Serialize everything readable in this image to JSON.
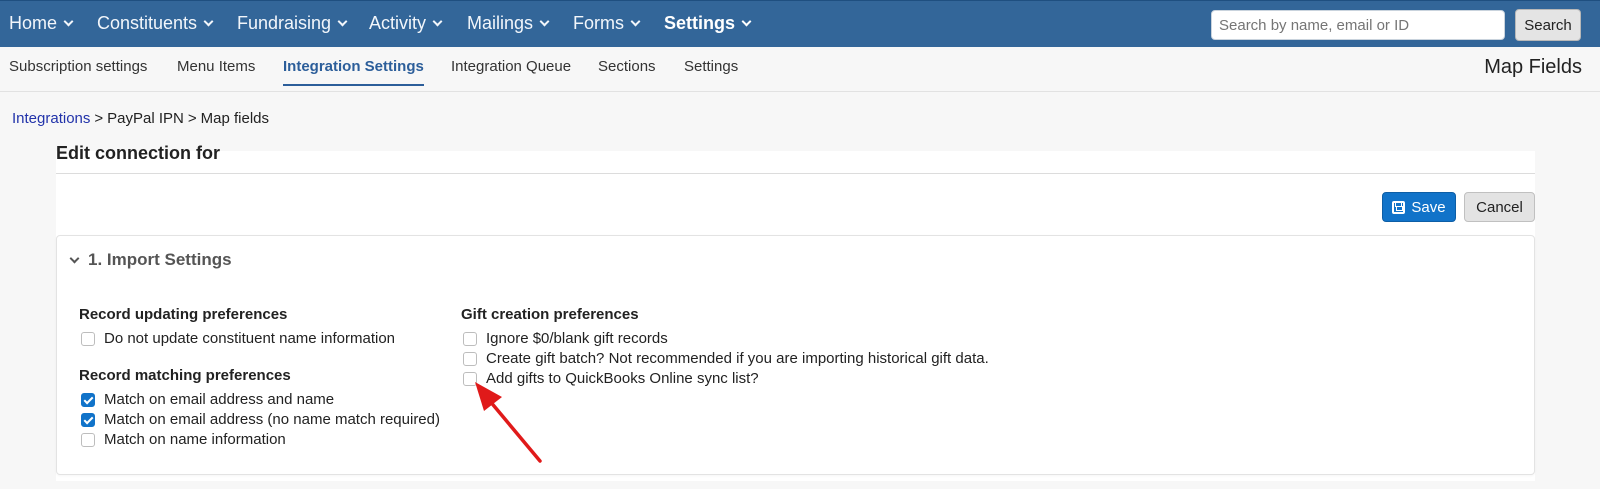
{
  "topnav": {
    "items": [
      {
        "label": "Home"
      },
      {
        "label": "Constituents"
      },
      {
        "label": "Fundraising"
      },
      {
        "label": "Activity"
      },
      {
        "label": "Mailings"
      },
      {
        "label": "Forms"
      },
      {
        "label": "Settings"
      }
    ],
    "active": "Settings",
    "search": {
      "placeholder": "Search by name, email or ID",
      "button_label": "Search"
    },
    "background_color": "#336699"
  },
  "subnav": {
    "items": [
      {
        "label": "Subscription settings"
      },
      {
        "label": "Menu Items"
      },
      {
        "label": "Integration Settings"
      },
      {
        "label": "Integration Queue"
      },
      {
        "label": "Sections"
      },
      {
        "label": "Settings"
      }
    ],
    "active": "Integration Settings",
    "page_title": "Map Fields"
  },
  "breadcrumb": {
    "items": [
      "Integrations",
      "PayPal IPN",
      "Map fields"
    ],
    "separator": ">"
  },
  "card": {
    "title": "Edit connection for",
    "save_label": "Save",
    "cancel_label": "Cancel",
    "accent_color": "#1173c9"
  },
  "section": {
    "title": "1. Import Settings",
    "record_updating": {
      "title": "Record updating preferences",
      "options": [
        {
          "label": "Do not update constituent name information",
          "checked": false
        }
      ]
    },
    "record_matching": {
      "title": "Record matching preferences",
      "options": [
        {
          "label": "Match on email address and name",
          "checked": true
        },
        {
          "label": "Match on email address (no name match required)",
          "checked": true
        },
        {
          "label": "Match on name information",
          "checked": false
        }
      ]
    },
    "gift_creation": {
      "title": "Gift creation preferences",
      "options": [
        {
          "label": "Ignore $0/blank gift records",
          "checked": false
        },
        {
          "label": "Create gift batch? Not recommended if you are importing historical gift data.",
          "checked": false
        },
        {
          "label": "Add gifts to QuickBooks Online sync list?",
          "checked": false
        }
      ]
    }
  },
  "annotation": {
    "icon": "red-arrow-icon",
    "color": "#e01a1a"
  }
}
